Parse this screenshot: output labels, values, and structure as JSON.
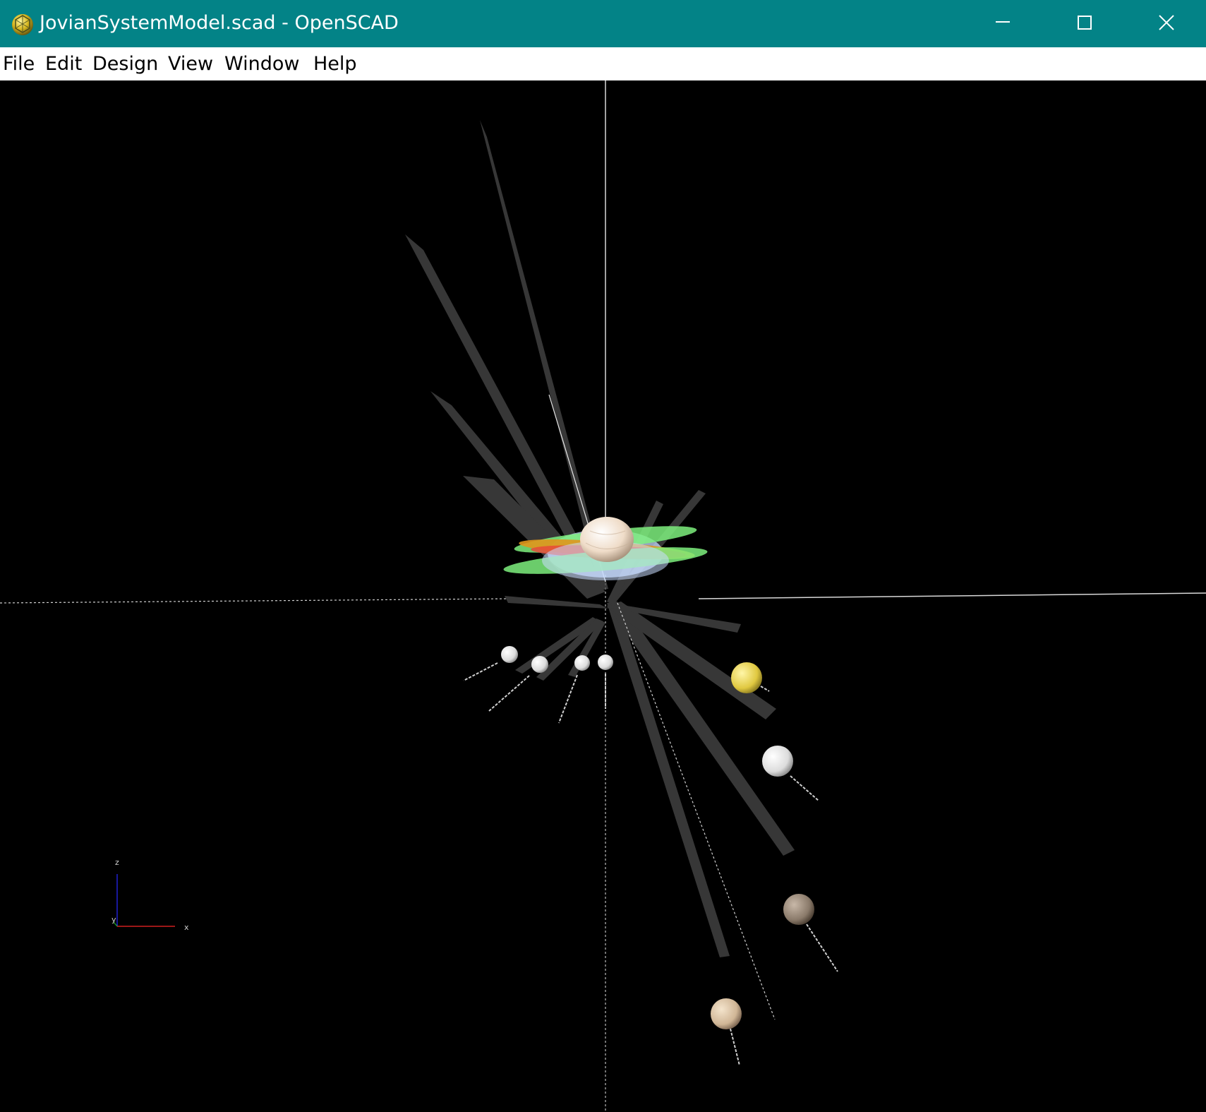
{
  "window": {
    "title": "JovianSystemModel.scad - OpenSCAD",
    "app_icon": "openscad-logo-icon",
    "controls": {
      "minimize": "minimize-icon",
      "maximize": "maximize-icon",
      "close": "close-icon"
    }
  },
  "menu": {
    "items": [
      "File",
      "Edit",
      "Design",
      "View",
      "Window",
      "Help"
    ]
  },
  "viewport": {
    "background": "#000000",
    "axes_indicator": {
      "z_label": "z",
      "x_label": "x",
      "y_label": "y",
      "x_color": "#d02020",
      "z_color": "#2020d0",
      "y_color": "#20b020"
    },
    "colors": {
      "orbit_plane": "#c8dcff",
      "ring_green": "#7ef07e",
      "ring_red": "#e84a3a",
      "ring_orange": "#e0961c",
      "orbit_sheet": "#4a4a4a",
      "planet": "#efdcc8",
      "moon_io": "#e6d24a",
      "moon_europa": "#eeeeee",
      "moon_ganymede": "#8a7a6a",
      "moon_callisto": "#d8c0a0"
    }
  }
}
